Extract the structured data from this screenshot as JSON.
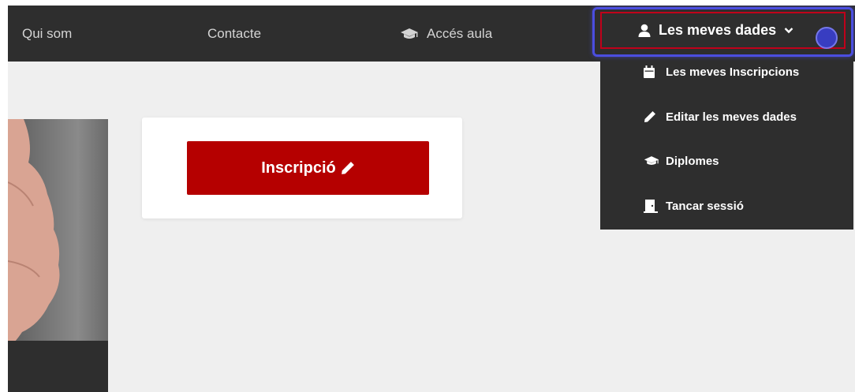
{
  "nav": {
    "items": [
      {
        "label": "Qui som"
      },
      {
        "label": "Contacte"
      },
      {
        "label": "Accés aula",
        "icon": "graduation-cap-icon"
      }
    ],
    "user_menu": {
      "label": "Les meves dades",
      "icon": "user-icon",
      "chevron_icon": "chevron-down-icon",
      "expanded": true,
      "items": [
        {
          "label": "Les meves Inscripcions",
          "icon": "calendar-icon"
        },
        {
          "label": "Editar les meves dades",
          "icon": "pencil-icon"
        },
        {
          "label": "Diplomes",
          "icon": "graduation-cap-icon"
        },
        {
          "label": "Tancar sessió",
          "icon": "door-icon"
        }
      ]
    }
  },
  "main": {
    "inscripcio_button": {
      "label": "Inscripció",
      "icon": "pencil-icon"
    }
  },
  "colors": {
    "navbar_bg": "#2e2e2e",
    "page_bg": "#efefef",
    "primary_red": "#b50000",
    "focus_outline": "#4b4ee0",
    "nav_text": "#d4d4d4"
  }
}
